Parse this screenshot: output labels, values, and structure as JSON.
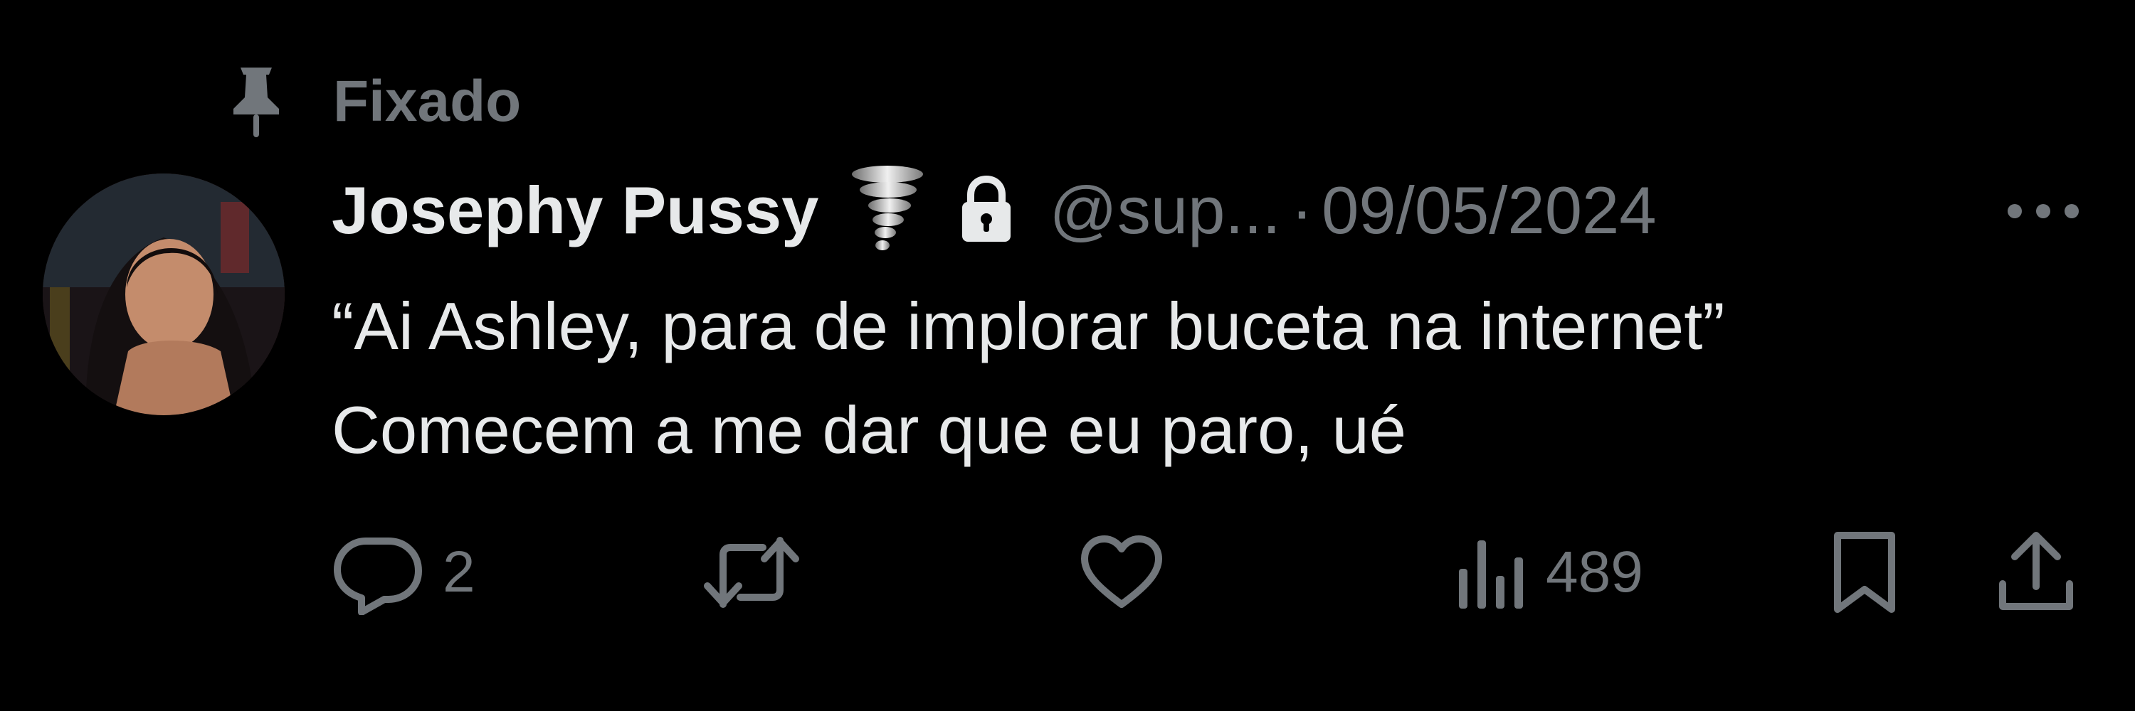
{
  "pinned": {
    "icon": "pin-icon",
    "label": "Fixado"
  },
  "author": {
    "avatar": "avatar",
    "display_name": "Josephy Pussy",
    "badges": [
      "tornado-icon",
      "lock-icon"
    ],
    "handle": "@sup...",
    "separator": "·",
    "date": "09/05/2024"
  },
  "body": {
    "line1": "“Ai Ashley, para de implorar buceta na internet”",
    "line2": "Comecem a me dar que eu paro, ué"
  },
  "actions": {
    "reply": {
      "icon": "reply-icon",
      "count": "2"
    },
    "repost": {
      "icon": "repost-icon",
      "count": ""
    },
    "like": {
      "icon": "heart-icon",
      "count": ""
    },
    "views": {
      "icon": "views-icon",
      "count": "489"
    },
    "bookmark": {
      "icon": "bookmark-icon"
    },
    "share": {
      "icon": "share-icon"
    }
  },
  "colors": {
    "background": "#000000",
    "primary_text": "#e7e9ea",
    "secondary_text": "#71767b"
  }
}
